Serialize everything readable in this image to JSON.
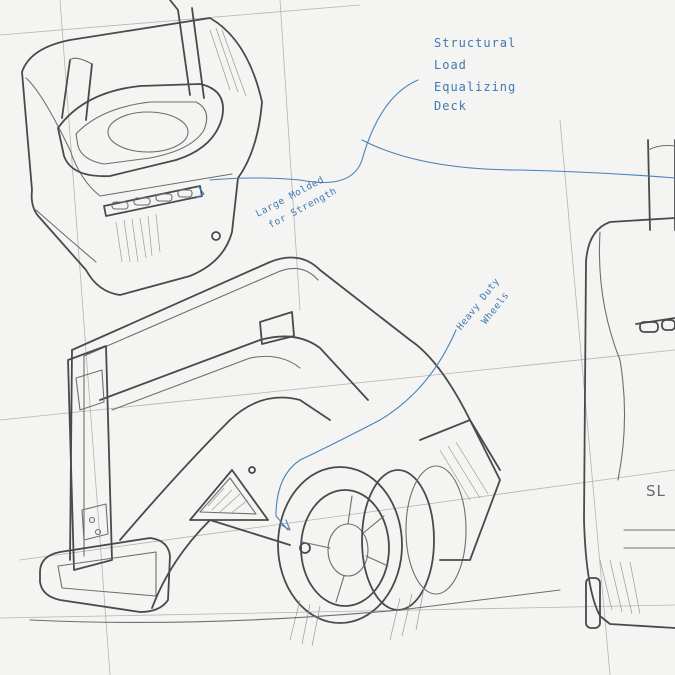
{
  "annotations": {
    "deck": [
      "Structural",
      "Load",
      "Equalizing",
      "Deck"
    ],
    "molded": [
      "Large Molded",
      "for Strength"
    ],
    "wheels": [
      "Heavy Duty",
      "Wheels"
    ]
  },
  "brand_mark": "SL",
  "colors": {
    "paper": "#f4f4f2",
    "pencil": "#6e6e6e",
    "ink": "#4a82b8"
  }
}
